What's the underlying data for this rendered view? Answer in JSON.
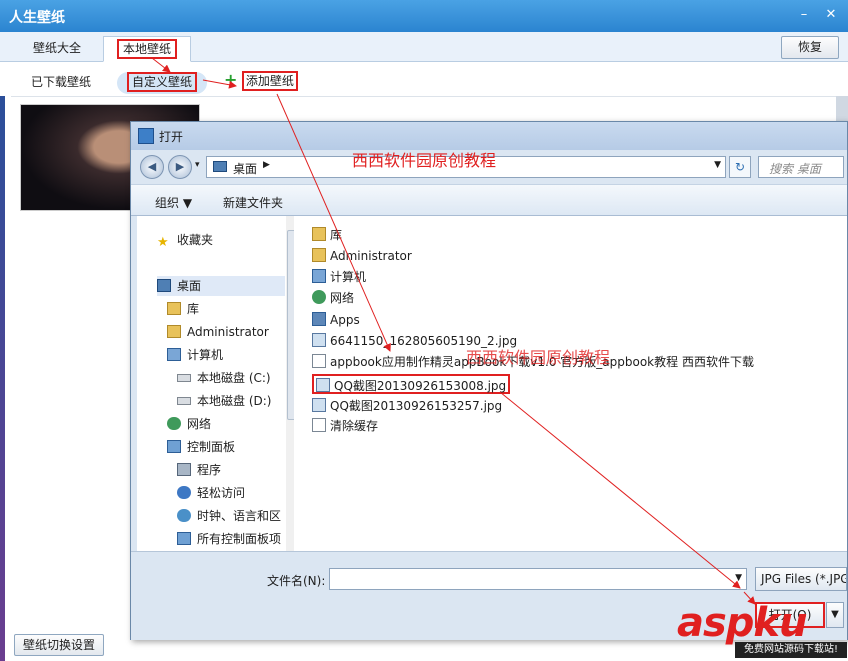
{
  "app": {
    "title": "人生壁纸",
    "min_glyph": "–",
    "close_glyph": "✕",
    "tabs": [
      {
        "label": "壁纸大全"
      },
      {
        "label": "本地壁纸"
      }
    ],
    "restore_label": "恢复",
    "subtabs": {
      "downloaded": "已下载壁纸",
      "custom": "自定义壁纸",
      "add": "添加壁纸",
      "add_glyph": "+"
    },
    "settings_button": "壁纸切换设置"
  },
  "dialog": {
    "title": "打开",
    "nav": {
      "back": "◀",
      "forward": "▶",
      "recent": "▾"
    },
    "address": {
      "location": "桌面",
      "sep": "▶",
      "dropdown": "▼",
      "refresh_glyph": "↻"
    },
    "search_placeholder": "搜索 桌面",
    "toolbar": {
      "organize": "组织 ▼",
      "new_folder": "新建文件夹"
    },
    "nav_pane": [
      {
        "label": "收藏夹",
        "icon": "star-icon"
      },
      {
        "label": "桌面",
        "icon": "desktop-icon"
      },
      {
        "label": "库",
        "icon": "library-icon"
      },
      {
        "label": "Administrator",
        "icon": "user-folder-icon"
      },
      {
        "label": "计算机",
        "icon": "computer-icon"
      },
      {
        "label": "本地磁盘 (C:)",
        "icon": "drive-icon"
      },
      {
        "label": "本地磁盘 (D:)",
        "icon": "drive-icon"
      },
      {
        "label": "网络",
        "icon": "network-icon"
      },
      {
        "label": "控制面板",
        "icon": "control-panel-icon"
      },
      {
        "label": "程序",
        "icon": "programs-icon"
      },
      {
        "label": "轻松访问",
        "icon": "ease-access-icon"
      },
      {
        "label": "时钟、语言和区",
        "icon": "clock-icon"
      },
      {
        "label": "所有控制面板项",
        "icon": "panel-items-icon"
      }
    ],
    "files": [
      {
        "name": "库",
        "icon": "library-icon"
      },
      {
        "name": "Administrator",
        "icon": "user-folder-icon"
      },
      {
        "name": "计算机",
        "icon": "computer-icon"
      },
      {
        "name": "网络",
        "icon": "network-icon"
      },
      {
        "name": "Apps",
        "icon": "apps-icon"
      },
      {
        "name": "6641150_162805605190_2.jpg",
        "icon": "image-file-icon"
      },
      {
        "name": "appbook应用制作精灵appBook下载v1.0 官方版_appbook教程 西西软件下载",
        "icon": "shortcut-icon"
      },
      {
        "name": "QQ截图20130926153008.jpg",
        "icon": "image-file-icon"
      },
      {
        "name": "QQ截图20130926153257.jpg",
        "icon": "image-file-icon"
      },
      {
        "name": "清除缓存",
        "icon": "shortcut-icon"
      }
    ],
    "filename_label": "文件名(N):",
    "filename_value": "",
    "filter_label": "JPG Files (*.JPG",
    "open_label": "打开(O)",
    "open_arrow": "▼"
  },
  "annotations": {
    "watermark": "西西软件园原创教程"
  },
  "logo": {
    "text": "aspku",
    "subtext": "免费网站源码下载站!"
  }
}
